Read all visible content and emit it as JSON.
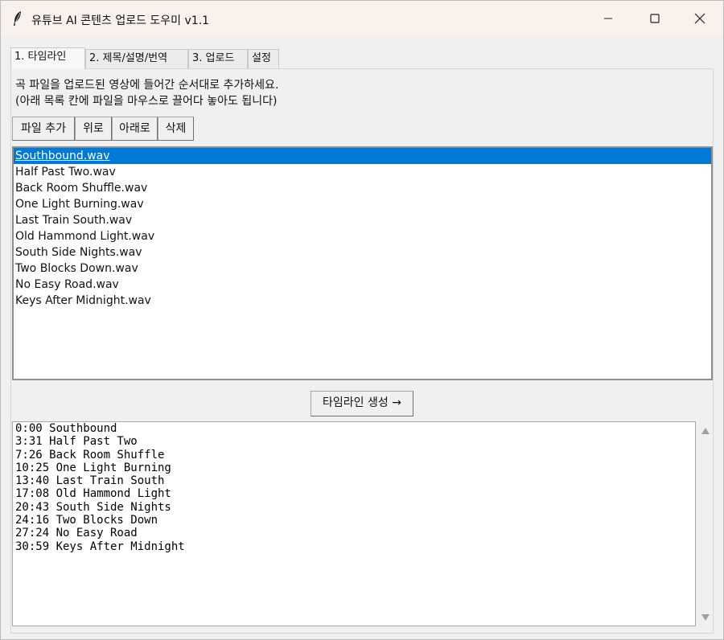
{
  "window": {
    "title": "유튜브 AI 콘텐츠 업로드 도우미 v1.1"
  },
  "tabs": [
    {
      "label": "1. 타임라인"
    },
    {
      "label": "2. 제목/설명/번역"
    },
    {
      "label": "3. 업로드"
    },
    {
      "label": "설정"
    }
  ],
  "instructions": {
    "line1": "곡 파일을 업로드된 영상에 들어간 순서대로 추가하세요.",
    "line2": "(아래 목록 칸에 파일을 마우스로 끌어다 놓아도 됩니다)"
  },
  "toolbar": {
    "add": "파일 추가",
    "up": "위로",
    "down": "아래로",
    "delete": "삭제"
  },
  "files": [
    "Southbound.wav",
    "Half Past Two.wav",
    "Back Room Shuffle.wav",
    "One Light Burning.wav",
    "Last Train South.wav",
    "Old Hammond Light.wav",
    "South Side Nights.wav",
    "Two Blocks Down.wav",
    "No Easy Road.wav",
    "Keys After Midnight.wav"
  ],
  "generate_button": "타임라인 생성 →",
  "timeline": [
    "0:00 Southbound",
    "3:31 Half Past Two",
    "7:26 Back Room Shuffle",
    "10:25 One Light Burning",
    "13:40 Last Train South",
    "17:08 Old Hammond Light",
    "20:43 South Side Nights",
    "24:16 Two Blocks Down",
    "27:24 No Easy Road",
    "30:59 Keys After Midnight"
  ],
  "colors": {
    "selection": "#0078d7",
    "titlebar": "#f9f1ec"
  }
}
